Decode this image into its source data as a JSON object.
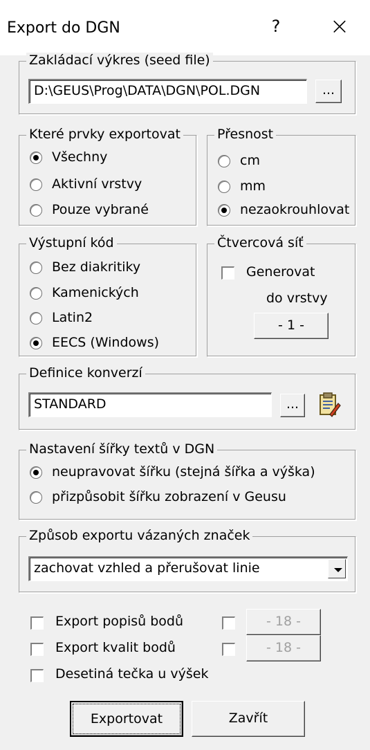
{
  "window": {
    "title": "Export do DGN",
    "help": "?",
    "close": "×"
  },
  "seed": {
    "legend": "Zakládací výkres (seed file)",
    "path": "D:\\GEUS\\Prog\\DATA\\DGN\\POL.DGN",
    "browse": "..."
  },
  "elements": {
    "legend": "Které prvky exportovat",
    "options": [
      "Všechny",
      "Aktivní vrstvy",
      "Pouze vybrané"
    ],
    "selected": 0
  },
  "precision": {
    "legend": "Přesnost",
    "options": [
      "cm",
      "mm",
      "nezaokrouhlovat"
    ],
    "selected": 2
  },
  "output_code": {
    "legend": "Výstupní kód",
    "options": [
      "Bez diakritiky",
      "Kamenických",
      "Latin2",
      "EECS (Windows)"
    ],
    "selected": 3
  },
  "grid": {
    "legend": "Čtvercová síť",
    "generate": "Generovat",
    "layer_label": "do vrstvy",
    "layer_button": "- 1 -"
  },
  "conversion": {
    "legend": "Definice konverzí",
    "value": "STANDARD",
    "browse": "...",
    "edit_icon": "clipboard-edit-icon"
  },
  "text_width": {
    "legend": "Nastavení šířky textů v DGN",
    "options": [
      "neupravovat šířku (stejná šířka a výška)",
      "přizpůsobit šířku zobrazení v Geusu"
    ],
    "selected": 0
  },
  "linked_signs": {
    "legend": "Způsob exportu vázaných značek",
    "value": "zachovat vzhled a přerušovat linie"
  },
  "options": {
    "export_point_labels": "Export popisů bodů",
    "export_point_quality": "Export kvalit bodů",
    "decimal_dot": "Desetiná tečka u výšek",
    "labels_level": "- 18 -",
    "quality_level": "- 18 -"
  },
  "buttons": {
    "export": "Exportovat",
    "close": "Zavřít"
  }
}
